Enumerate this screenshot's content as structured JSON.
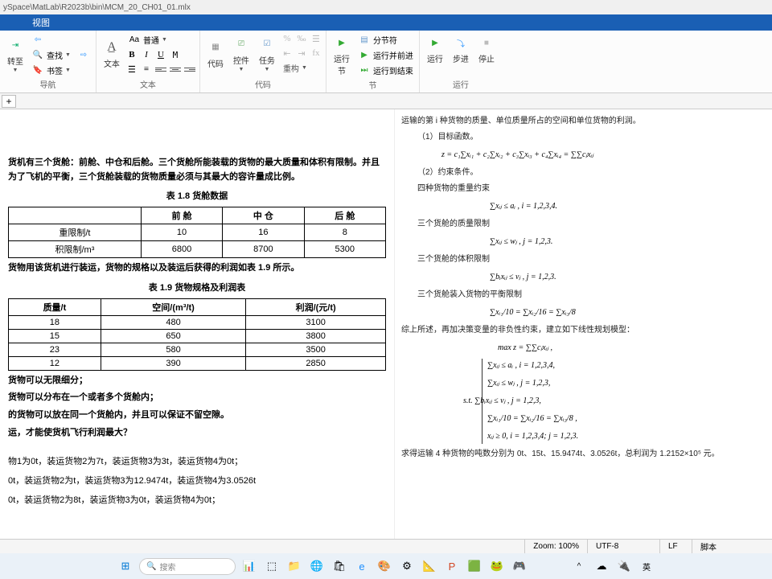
{
  "title_path": "ySpace\\MatLab\\R2023b\\bin\\MCM_20_CH01_01.mlx",
  "menubar": {
    "view": "视图"
  },
  "toolbar": {
    "nav": {
      "goto": "转至",
      "find": "查找",
      "bookmark": "书签",
      "group": "导航"
    },
    "text": {
      "normal": "普通",
      "text_label": "文本",
      "group": "文本"
    },
    "code": {
      "code": "代码",
      "control": "控件",
      "task": "任务",
      "group": "代码"
    },
    "section": {
      "refactor": "重构",
      "runsec": "运行\n节",
      "split": "分节符",
      "run_advance": "运行并前进",
      "run_to_end": "运行到结束",
      "group": "节"
    },
    "run": {
      "run": "运行",
      "step": "步进",
      "stop": "停止",
      "group": "运行"
    }
  },
  "doc": {
    "p1": "货机有三个货舱：前舱、中仓和后舱。三个货舱所能装载的货物的最大质量和体积有限制。并且为了飞机的平衡，三个货舱装载的货物质量必须与其最大的容许量成比例。",
    "t1_title": "表 1.8  货舱数据",
    "t1_headers": [
      "",
      "前  舱",
      "中  仓",
      "后  舱"
    ],
    "t1_rows": [
      [
        "重限制/t",
        "10",
        "16",
        "8"
      ],
      [
        "积限制/m³",
        "6800",
        "8700",
        "5300"
      ]
    ],
    "p2": "货物用该货机进行装运，货物的规格以及装运后获得的利润如表 1.9 所示。",
    "t2_title": "表 1.9  货物规格及利润表",
    "t2_headers": [
      "质量/t",
      "空间/(m³/t)",
      "利润/(元/t)"
    ],
    "t2_rows": [
      [
        "18",
        "480",
        "3100"
      ],
      [
        "15",
        "650",
        "3800"
      ],
      [
        "23",
        "580",
        "3500"
      ],
      [
        "12",
        "390",
        "2850"
      ]
    ],
    "p3a": "货物可以无限细分；",
    "p3b": "货物可以分布在一个或者多个货舱内；",
    "p3c": "的货物可以放在同一个货舱内，并且可以保证不留空隙。",
    "p3d": "运，才能使货机飞行利润最大？",
    "r1": "物1为0t，装运货物2为7t，装运货物3为3t，装运货物4为0t；",
    "r2": "0t，装运货物2为t，装运货物3为12.9474t，装运货物4为3.0526t",
    "r3": "0t，装运货物2为8t，装运货物3为0t，装运货物4为0t；"
  },
  "right": {
    "l0": "运输的第 i 种货物的质量、单位质量所占的空间和单位货物的利润。",
    "l1": "（1）目标函数。",
    "eq1": "z = c₁∑xᵢ₁ + c₂∑xᵢ₂ + c₃∑xᵢ₃ + c₄∑xᵢ₄ = ∑∑cⱼxᵢⱼ",
    "l2": "（2）约束条件。",
    "l3": "四种货物的重量约束",
    "eq2": "∑xᵢⱼ ≤ aᵢ ,   i = 1,2,3,4.",
    "l4": "三个货舱的质量限制",
    "eq3": "∑xᵢⱼ ≤ wⱼ , j = 1,2,3.",
    "l5": "三个货舱的体积限制",
    "eq4": "∑bᵢxᵢⱼ ≤ vⱼ , j = 1,2,3.",
    "l6": "三个货舱装入货物的平衡限制",
    "eq5": "∑xᵢ₁/10 = ∑xᵢ₂/16 = ∑xᵢ₃/8",
    "l7": "综上所述，再加决策变量的非负性约束，建立如下线性规划模型：",
    "eq6": "max z = ∑∑cⱼxᵢⱼ ,",
    "eq7a": "∑xᵢⱼ ≤ aᵢ ,   i = 1,2,3,4,",
    "eq7b": "∑xᵢⱼ ≤ wⱼ ,   j = 1,2,3,",
    "eq7c": "s.t.  ∑bᵢxᵢⱼ ≤ vⱼ ,   j = 1,2,3,",
    "eq7d": "∑xᵢ₁/10 = ∑xᵢ₂/16 = ∑xᵢ₃/8 ,",
    "eq7e": "xᵢⱼ ≥ 0,   i = 1,2,3,4; j = 1,2,3.",
    "l8": "求得运输 4 种货物的吨数分别为 0t、15t、15.9474t、3.0526t，总利润为 1.2152×10⁵ 元。"
  },
  "status": {
    "zoom": "Zoom: 100%",
    "encoding": "UTF-8",
    "eol": "LF",
    "mode": "脚本"
  },
  "taskbar": {
    "search_placeholder": "搜索",
    "ime": "英"
  },
  "colors": {
    "ribbon": "#1a5fb4"
  }
}
